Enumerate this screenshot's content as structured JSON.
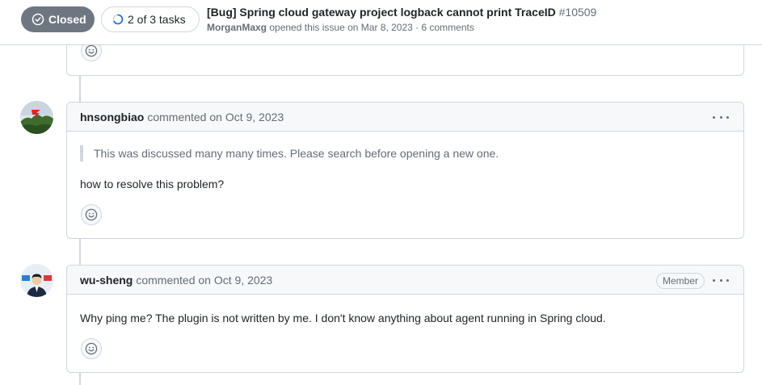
{
  "header": {
    "state": "Closed",
    "tasks": "2 of 3 tasks",
    "title": "[Bug] Spring cloud gateway project logback cannot print TraceID",
    "number": "#10509",
    "author": "MorganMaxg",
    "meta": "opened this issue on Mar 8, 2023 · 6 comments"
  },
  "comments": [
    {
      "login": "hnsongbiao",
      "action": "commented on Oct 9, 2023",
      "quote": "This was discussed many many times. Please search before opening a new one.",
      "body": "how to resolve this problem?"
    },
    {
      "login": "wu-sheng",
      "action": "commented on Oct 9, 2023",
      "role": "Member",
      "body": "Why ping me? The plugin is not written by me. I don't know anything about agent running in Spring cloud."
    }
  ],
  "icons": [
    "check-circle-icon",
    "task-progress-icon",
    "smiley-icon",
    "kebab-horizontal-icon"
  ],
  "colors": {
    "closed_badge": "#6e7781",
    "border": "#d0d7de",
    "header_bg": "#f6f8fa",
    "muted": "#656d76"
  }
}
